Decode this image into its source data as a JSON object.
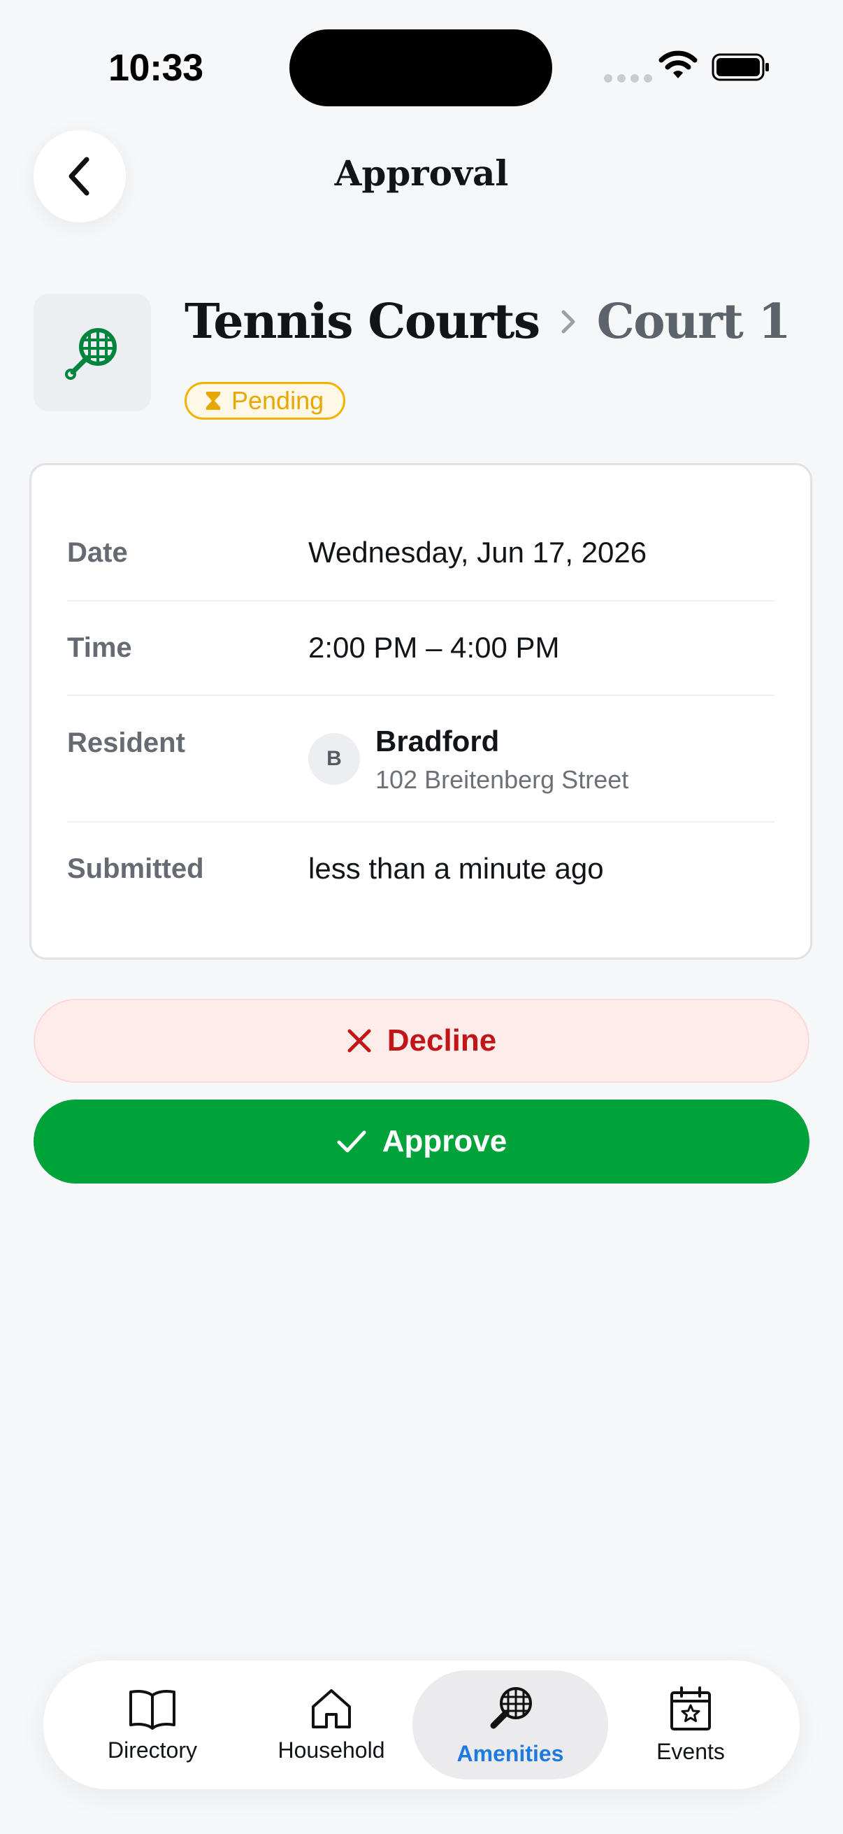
{
  "status_bar": {
    "time": "10:33"
  },
  "header": {
    "title": "Approval"
  },
  "amenity": {
    "name": "Tennis Courts",
    "sub": "Court 1",
    "status": "Pending"
  },
  "details": {
    "date_label": "Date",
    "date_value": "Wednesday, Jun 17, 2026",
    "time_label": "Time",
    "time_value": "2:00 PM – 4:00 PM",
    "resident_label": "Resident",
    "resident_initial": "B",
    "resident_name": "Bradford",
    "resident_address": "102 Breitenberg Street",
    "submitted_label": "Submitted",
    "submitted_value": "less than a minute ago"
  },
  "actions": {
    "decline": "Decline",
    "approve": "Approve"
  },
  "tabs": [
    {
      "label": "Directory",
      "icon": "book-icon"
    },
    {
      "label": "Household",
      "icon": "house-icon"
    },
    {
      "label": "Amenities",
      "icon": "racket-icon",
      "active": true
    },
    {
      "label": "Events",
      "icon": "calendar-star-icon"
    }
  ],
  "colors": {
    "approve": "#00a33a",
    "decline": "#c11518",
    "pending": "#e6a800",
    "active_tab": "#1f7ae0",
    "amenity_icon": "#00853e"
  }
}
